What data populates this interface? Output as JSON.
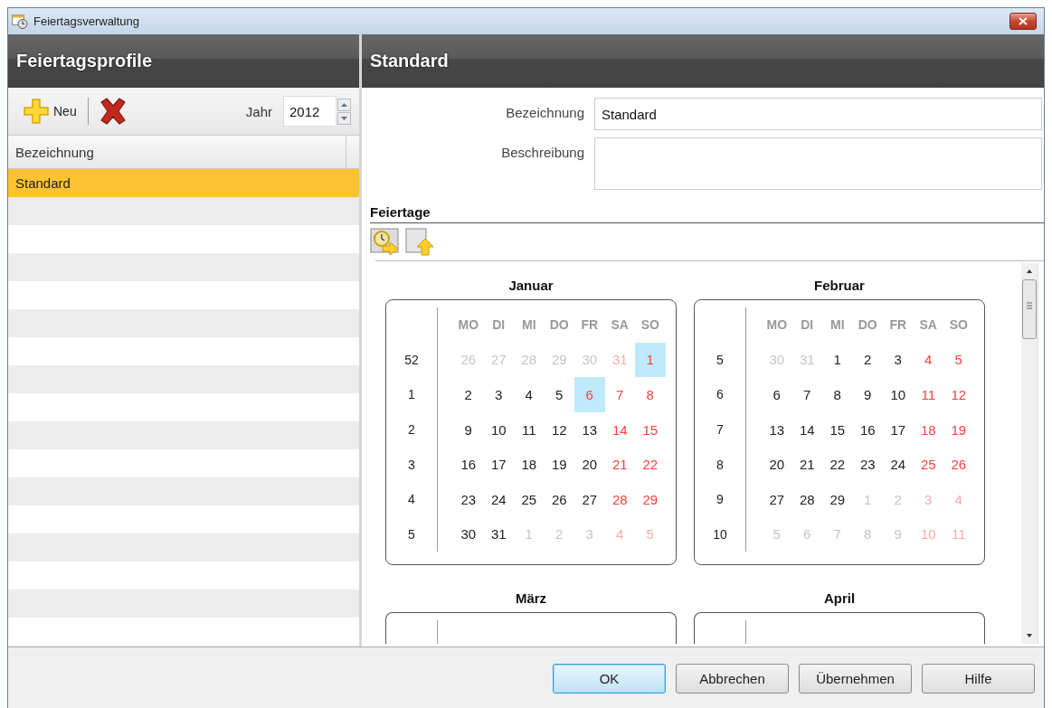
{
  "window": {
    "title": "Feiertagsverwaltung"
  },
  "profiles_panel": {
    "title": "Feiertagsprofile",
    "new_button": "Neu",
    "year_label": "Jahr",
    "year_value": "2012",
    "column": "Bezeichnung",
    "rows": [
      {
        "label": "Standard",
        "selected": true
      }
    ]
  },
  "detail": {
    "title": "Standard",
    "name_label": "Bezeichnung",
    "name_value": "Standard",
    "description_label": "Beschreibung",
    "holidays_title": "Feiertage",
    "months": [
      {
        "name": "Januar",
        "weekdays": [
          "MO",
          "DI",
          "MI",
          "DO",
          "FR",
          "SA",
          "SO"
        ],
        "weeks": [
          {
            "week": "52",
            "days": [
              {
                "d": "26",
                "outside": true,
                "weekend": false,
                "holiday": false
              },
              {
                "d": "27",
                "outside": true,
                "weekend": false,
                "holiday": false
              },
              {
                "d": "28",
                "outside": true,
                "weekend": false,
                "holiday": false
              },
              {
                "d": "29",
                "outside": true,
                "weekend": false,
                "holiday": false
              },
              {
                "d": "30",
                "outside": true,
                "weekend": false,
                "holiday": false
              },
              {
                "d": "31",
                "outside": true,
                "weekend": true,
                "holiday": false
              },
              {
                "d": "1",
                "outside": false,
                "weekend": true,
                "holiday": true
              }
            ]
          },
          {
            "week": "1",
            "days": [
              {
                "d": "2",
                "outside": false,
                "weekend": false,
                "holiday": false
              },
              {
                "d": "3",
                "outside": false,
                "weekend": false,
                "holiday": false
              },
              {
                "d": "4",
                "outside": false,
                "weekend": false,
                "holiday": false
              },
              {
                "d": "5",
                "outside": false,
                "weekend": false,
                "holiday": false
              },
              {
                "d": "6",
                "outside": false,
                "weekend": false,
                "holiday": true
              },
              {
                "d": "7",
                "outside": false,
                "weekend": true,
                "holiday": false
              },
              {
                "d": "8",
                "outside": false,
                "weekend": true,
                "holiday": false
              }
            ]
          },
          {
            "week": "2",
            "days": [
              {
                "d": "9",
                "outside": false,
                "weekend": false,
                "holiday": false
              },
              {
                "d": "10",
                "outside": false,
                "weekend": false,
                "holiday": false
              },
              {
                "d": "11",
                "outside": false,
                "weekend": false,
                "holiday": false
              },
              {
                "d": "12",
                "outside": false,
                "weekend": false,
                "holiday": false
              },
              {
                "d": "13",
                "outside": false,
                "weekend": false,
                "holiday": false
              },
              {
                "d": "14",
                "outside": false,
                "weekend": true,
                "holiday": false
              },
              {
                "d": "15",
                "outside": false,
                "weekend": true,
                "holiday": false
              }
            ]
          },
          {
            "week": "3",
            "days": [
              {
                "d": "16",
                "outside": false,
                "weekend": false,
                "holiday": false
              },
              {
                "d": "17",
                "outside": false,
                "weekend": false,
                "holiday": false
              },
              {
                "d": "18",
                "outside": false,
                "weekend": false,
                "holiday": false
              },
              {
                "d": "19",
                "outside": false,
                "weekend": false,
                "holiday": false
              },
              {
                "d": "20",
                "outside": false,
                "weekend": false,
                "holiday": false
              },
              {
                "d": "21",
                "outside": false,
                "weekend": true,
                "holiday": false
              },
              {
                "d": "22",
                "outside": false,
                "weekend": true,
                "holiday": false
              }
            ]
          },
          {
            "week": "4",
            "days": [
              {
                "d": "23",
                "outside": false,
                "weekend": false,
                "holiday": false
              },
              {
                "d": "24",
                "outside": false,
                "weekend": false,
                "holiday": false
              },
              {
                "d": "25",
                "outside": false,
                "weekend": false,
                "holiday": false
              },
              {
                "d": "26",
                "outside": false,
                "weekend": false,
                "holiday": false
              },
              {
                "d": "27",
                "outside": false,
                "weekend": false,
                "holiday": false
              },
              {
                "d": "28",
                "outside": false,
                "weekend": true,
                "holiday": false
              },
              {
                "d": "29",
                "outside": false,
                "weekend": true,
                "holiday": false
              }
            ]
          },
          {
            "week": "5",
            "days": [
              {
                "d": "30",
                "outside": false,
                "weekend": false,
                "holiday": false
              },
              {
                "d": "31",
                "outside": false,
                "weekend": false,
                "holiday": false
              },
              {
                "d": "1",
                "outside": true,
                "weekend": false,
                "holiday": false
              },
              {
                "d": "2",
                "outside": true,
                "weekend": false,
                "holiday": false
              },
              {
                "d": "3",
                "outside": true,
                "weekend": false,
                "holiday": false
              },
              {
                "d": "4",
                "outside": true,
                "weekend": true,
                "holiday": false
              },
              {
                "d": "5",
                "outside": true,
                "weekend": true,
                "holiday": false
              }
            ]
          }
        ]
      },
      {
        "name": "Februar",
        "weekdays": [
          "MO",
          "DI",
          "MI",
          "DO",
          "FR",
          "SA",
          "SO"
        ],
        "weeks": [
          {
            "week": "5",
            "days": [
              {
                "d": "30",
                "outside": true,
                "weekend": false,
                "holiday": false
              },
              {
                "d": "31",
                "outside": true,
                "weekend": false,
                "holiday": false
              },
              {
                "d": "1",
                "outside": false,
                "weekend": false,
                "holiday": false
              },
              {
                "d": "2",
                "outside": false,
                "weekend": false,
                "holiday": false
              },
              {
                "d": "3",
                "outside": false,
                "weekend": false,
                "holiday": false
              },
              {
                "d": "4",
                "outside": false,
                "weekend": true,
                "holiday": false
              },
              {
                "d": "5",
                "outside": false,
                "weekend": true,
                "holiday": false
              }
            ]
          },
          {
            "week": "6",
            "days": [
              {
                "d": "6",
                "outside": false,
                "weekend": false,
                "holiday": false
              },
              {
                "d": "7",
                "outside": false,
                "weekend": false,
                "holiday": false
              },
              {
                "d": "8",
                "outside": false,
                "weekend": false,
                "holiday": false
              },
              {
                "d": "9",
                "outside": false,
                "weekend": false,
                "holiday": false
              },
              {
                "d": "10",
                "outside": false,
                "weekend": false,
                "holiday": false
              },
              {
                "d": "11",
                "outside": false,
                "weekend": true,
                "holiday": false
              },
              {
                "d": "12",
                "outside": false,
                "weekend": true,
                "holiday": false
              }
            ]
          },
          {
            "week": "7",
            "days": [
              {
                "d": "13",
                "outside": false,
                "weekend": false,
                "holiday": false
              },
              {
                "d": "14",
                "outside": false,
                "weekend": false,
                "holiday": false
              },
              {
                "d": "15",
                "outside": false,
                "weekend": false,
                "holiday": false
              },
              {
                "d": "16",
                "outside": false,
                "weekend": false,
                "holiday": false
              },
              {
                "d": "17",
                "outside": false,
                "weekend": false,
                "holiday": false
              },
              {
                "d": "18",
                "outside": false,
                "weekend": true,
                "holiday": false
              },
              {
                "d": "19",
                "outside": false,
                "weekend": true,
                "holiday": false
              }
            ]
          },
          {
            "week": "8",
            "days": [
              {
                "d": "20",
                "outside": false,
                "weekend": false,
                "holiday": false
              },
              {
                "d": "21",
                "outside": false,
                "weekend": false,
                "holiday": false
              },
              {
                "d": "22",
                "outside": false,
                "weekend": false,
                "holiday": false
              },
              {
                "d": "23",
                "outside": false,
                "weekend": false,
                "holiday": false
              },
              {
                "d": "24",
                "outside": false,
                "weekend": false,
                "holiday": false
              },
              {
                "d": "25",
                "outside": false,
                "weekend": true,
                "holiday": false
              },
              {
                "d": "26",
                "outside": false,
                "weekend": true,
                "holiday": false
              }
            ]
          },
          {
            "week": "9",
            "days": [
              {
                "d": "27",
                "outside": false,
                "weekend": false,
                "holiday": false
              },
              {
                "d": "28",
                "outside": false,
                "weekend": false,
                "holiday": false
              },
              {
                "d": "29",
                "outside": false,
                "weekend": false,
                "holiday": false
              },
              {
                "d": "1",
                "outside": true,
                "weekend": false,
                "holiday": false
              },
              {
                "d": "2",
                "outside": true,
                "weekend": false,
                "holiday": false
              },
              {
                "d": "3",
                "outside": true,
                "weekend": true,
                "holiday": false
              },
              {
                "d": "4",
                "outside": true,
                "weekend": true,
                "holiday": false
              }
            ]
          },
          {
            "week": "10",
            "days": [
              {
                "d": "5",
                "outside": true,
                "weekend": false,
                "holiday": false
              },
              {
                "d": "6",
                "outside": true,
                "weekend": false,
                "holiday": false
              },
              {
                "d": "7",
                "outside": true,
                "weekend": false,
                "holiday": false
              },
              {
                "d": "8",
                "outside": true,
                "weekend": false,
                "holiday": false
              },
              {
                "d": "9",
                "outside": true,
                "weekend": false,
                "holiday": false
              },
              {
                "d": "10",
                "outside": true,
                "weekend": true,
                "holiday": false
              },
              {
                "d": "11",
                "outside": true,
                "weekend": true,
                "holiday": false
              }
            ]
          }
        ]
      },
      {
        "name": "März"
      },
      {
        "name": "April"
      }
    ]
  },
  "buttons": [
    {
      "label": "OK",
      "default": true
    },
    {
      "label": "Abbrechen",
      "default": false
    },
    {
      "label": "Übernehmen",
      "default": false
    },
    {
      "label": "Hilfe",
      "default": false
    }
  ]
}
